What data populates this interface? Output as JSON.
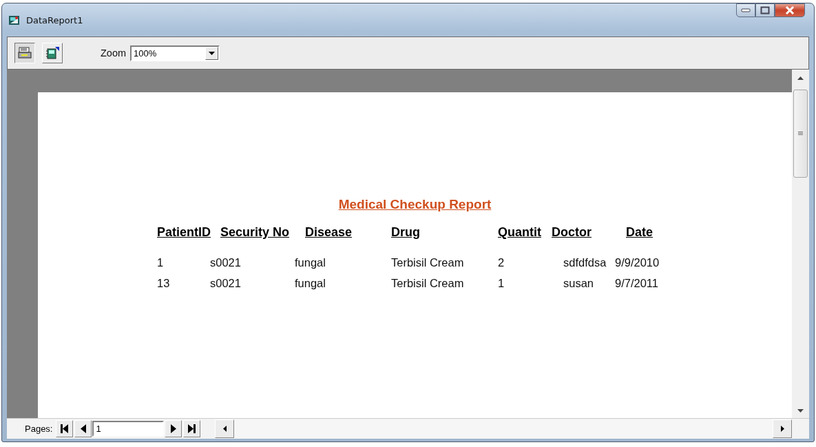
{
  "window": {
    "title": "DataReport1"
  },
  "toolbar": {
    "zoom_label": "Zoom",
    "zoom_value": "100%"
  },
  "report": {
    "title": "Medical Checkup Report",
    "columns": [
      "PatientID",
      "Security No",
      "Disease",
      "Drug",
      "Quantit",
      "Doctor",
      "Date"
    ],
    "rows": [
      [
        "1",
        "s0021",
        "fungal",
        "Terbisil Cream",
        "2",
        "sdfdfdsa",
        "9/9/2010"
      ],
      [
        "13",
        "s0021",
        "fungal",
        "Terbisil Cream",
        "1",
        "susan",
        "9/7/2011"
      ]
    ]
  },
  "pager": {
    "label": "Pages:",
    "page": "1"
  }
}
